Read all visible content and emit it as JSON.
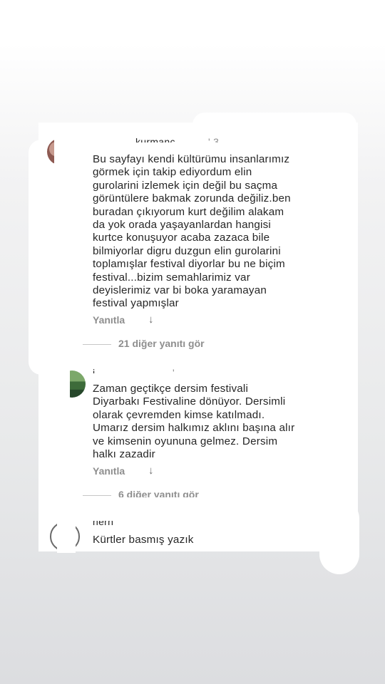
{
  "comments": [
    {
      "username": "kurmanc...",
      "time_snippet": "' 3",
      "lines": [
        "Bu sayfayı kendi kültürümu insanlarımız",
        "görmek için takip ediyordum elin",
        "gurolarini izlemek için değil bu saçma",
        "görüntülere bakmak zorunda değiliz.ben",
        "buradan çıkıyorum kurt değilim alakam",
        "da yok orada yaşayanlardan hangisi",
        "kurtce konuşuyor acaba zazaca bile",
        "bilmiyorlar digru duzgun elin gurolarini",
        "toplamışlar festival diyorlar bu ne biçim",
        "festival...bizim semahlarimiz var",
        "deyislerimiz var bi boka yaramayan",
        "festival yapmışlar"
      ],
      "reply_label": "Yanıtla",
      "view_replies": "21 diğer yanıtı gör"
    },
    {
      "username": "i...",
      "time_snippet": "'",
      "lines": [
        "Zaman geçtikçe dersim festivali",
        "Diyarbakı Festivaline dönüyor. Dersimli",
        "olarak çevremden kimse katılmadı.",
        "Umarız dersim halkımız aklını başına alır",
        "ve kimsenin oyununa gelmez. Dersim",
        "halkı zazadir"
      ],
      "reply_label": "Yanıtla",
      "view_replies": "6 diğer yanıtı gör"
    },
    {
      "username": "hern",
      "lines": [
        "Kürtler basmış yazık"
      ]
    }
  ],
  "icons": {
    "reply_arrow": "arrow-down-icon"
  },
  "colors": {
    "text": "#262626",
    "muted": "#8e8e8e"
  }
}
